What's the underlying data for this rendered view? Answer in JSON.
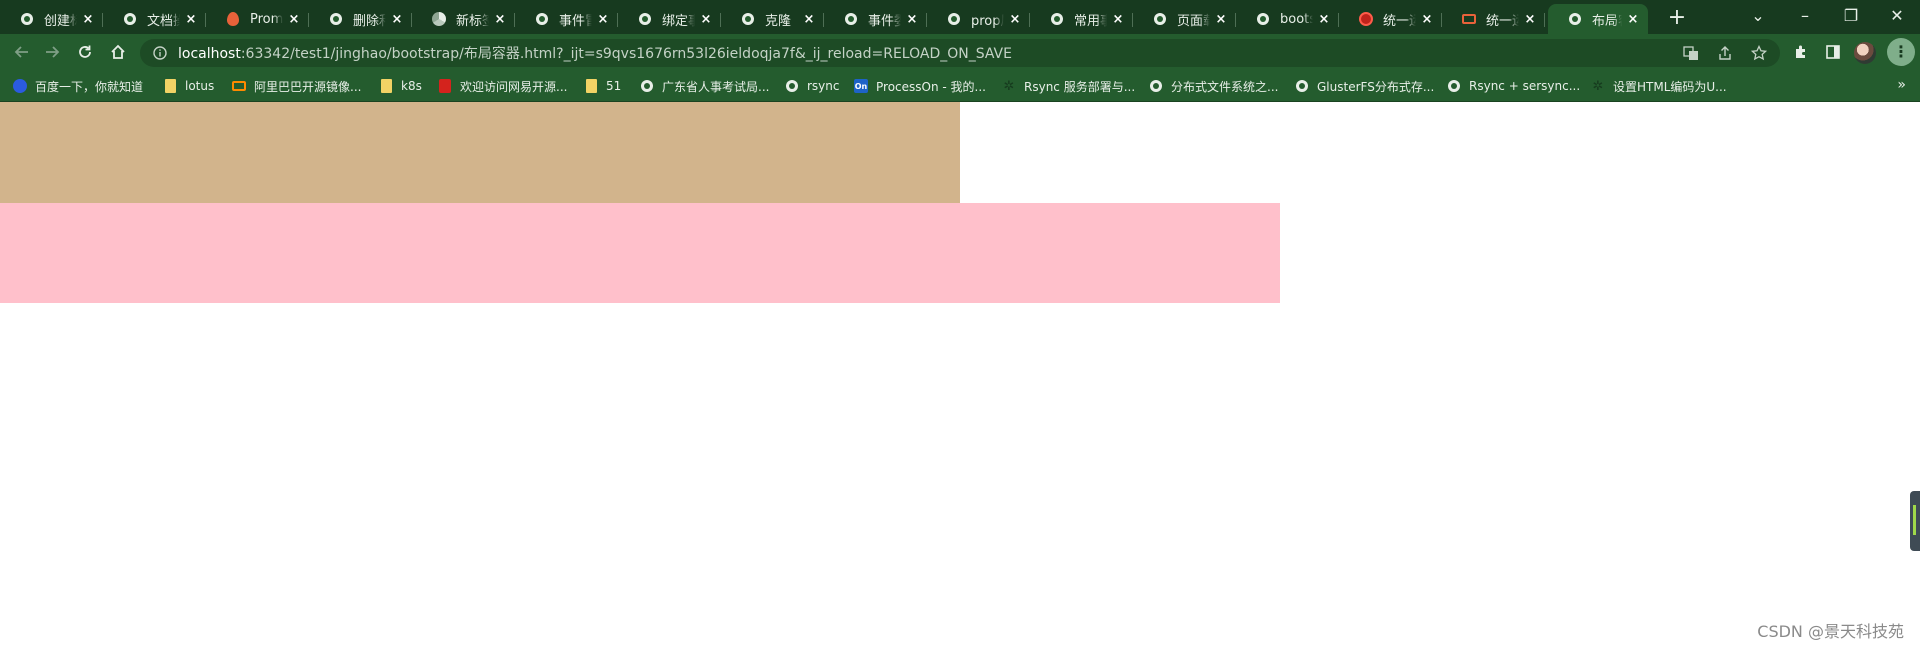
{
  "browser": {
    "tabs": [
      {
        "title": "创建标签",
        "favicon": "globe-icon",
        "active": false
      },
      {
        "title": "文档操作",
        "favicon": "globe-icon",
        "active": false
      },
      {
        "title": "Prometheus",
        "favicon": "flame-icon",
        "active": false
      },
      {
        "title": "删除和",
        "favicon": "globe-icon",
        "active": false
      },
      {
        "title": "新标签页",
        "favicon": "chrome-icon",
        "active": false
      },
      {
        "title": "事件冒泡",
        "favicon": "globe-icon",
        "active": false
      },
      {
        "title": "绑定事件",
        "favicon": "globe-icon",
        "active": false
      },
      {
        "title": "克隆",
        "favicon": "globe-icon",
        "active": false
      },
      {
        "title": "事件委托",
        "favicon": "globe-icon",
        "active": false
      },
      {
        "title": "prop属性",
        "favicon": "globe-icon",
        "active": false
      },
      {
        "title": "常用事件",
        "favicon": "globe-icon",
        "active": false
      },
      {
        "title": "页面载入",
        "favicon": "globe-icon",
        "active": false
      },
      {
        "title": "bootstrap",
        "favicon": "globe-icon",
        "active": false
      },
      {
        "title": "统一运维",
        "favicon": "red-logo-icon",
        "active": false
      },
      {
        "title": "统一运维",
        "favicon": "multicolor-logo-icon",
        "active": false
      },
      {
        "title": "布局容器",
        "favicon": "globe-icon",
        "active": true
      }
    ],
    "new_tab_label": "+",
    "window_controls": {
      "dropdown": "⌄",
      "minimize": "–",
      "restore": "❐",
      "close": "✕"
    }
  },
  "toolbar": {
    "url_host": "localhost",
    "url_rest": ":63342/test1/jinghao/bootstrap/布局容器.html?_ijt=s9qvs1676rn53l26ieldoqja7f&_ij_reload=RELOAD_ON_SAVE",
    "menu_label": "⋮"
  },
  "bookmarks": [
    {
      "label": "百度一下，你就知道",
      "icon": "paw-icon"
    },
    {
      "label": "lotus",
      "icon": "folder-icon"
    },
    {
      "label": "阿里巴巴开源镜像...",
      "icon": "alibaba-icon"
    },
    {
      "label": "k8s",
      "icon": "folder-icon"
    },
    {
      "label": "欢迎访问网易开源...",
      "icon": "netease-icon"
    },
    {
      "label": "51",
      "icon": "folder-icon"
    },
    {
      "label": "广东省人事考试局...",
      "icon": "globe-icon"
    },
    {
      "label": "rsync",
      "icon": "globe-icon"
    },
    {
      "label": "ProcessOn - 我的...",
      "icon": "processon-icon"
    },
    {
      "label": "Rsync 服务部署与...",
      "icon": "scribe-icon"
    },
    {
      "label": "分布式文件系统之...",
      "icon": "globe-icon"
    },
    {
      "label": "GlusterFS分布式存...",
      "icon": "globe-icon"
    },
    {
      "label": "Rsync + sersync...",
      "icon": "globe-icon"
    },
    {
      "label": "设置HTML编码为U...",
      "icon": "scribe-icon"
    }
  ],
  "bookmarks_more": "»",
  "page": {
    "colors": {
      "tan_box": "#d2b48c",
      "pink_box": "#ffc0cb"
    },
    "watermark": "CSDN @景天科技苑"
  }
}
